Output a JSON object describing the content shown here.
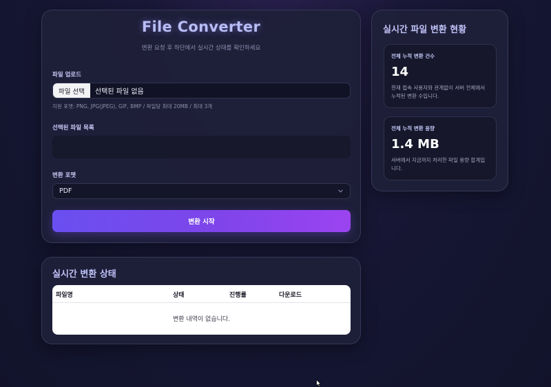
{
  "converter": {
    "title": "File Converter",
    "subtitle": "변환 요청 후 하단에서 실시간 상태를 확인하세요",
    "upload": {
      "label": "파일 업로드",
      "button_label": "파일 선택",
      "no_file_text": "선택된 파일 없음",
      "formats_note": "지원 포맷: PNG, JPG(JPEG), GIF, BMP / 파일당 최대 20MB / 최대 3개"
    },
    "selected_files": {
      "label": "선택된 파일 목록",
      "items": []
    },
    "format": {
      "label": "변환 포맷",
      "selected": "PDF"
    },
    "start_button_label": "변환 시작"
  },
  "stats": {
    "title": "실시간 파일 변환 현황",
    "total_count": {
      "label": "전체 누적 변환 건수",
      "value": "14",
      "description": "현재 접속 사용자와 관계없이 서버 전체에서 누적된 변환 수입니다."
    },
    "total_size": {
      "label": "전체 누적 변환 용량",
      "value": "1.4 MB",
      "description": "서버에서 지금까지 처리한 파일 용량 합계입니다."
    }
  },
  "status": {
    "title": "실시간 변환 상태",
    "columns": [
      "파일명",
      "상태",
      "진행률",
      "다운로드"
    ],
    "empty_text": "변환 내역이 없습니다.",
    "rows": []
  },
  "icons": {
    "select_arrow": "chevron-down-icon",
    "cursor": "mouse-pointer-icon"
  },
  "colors": {
    "accent_start": "#6a4ff0",
    "accent_end": "#9b44f0",
    "panel_bg": "#1e1f38",
    "title_color": "#b9bdf5"
  }
}
